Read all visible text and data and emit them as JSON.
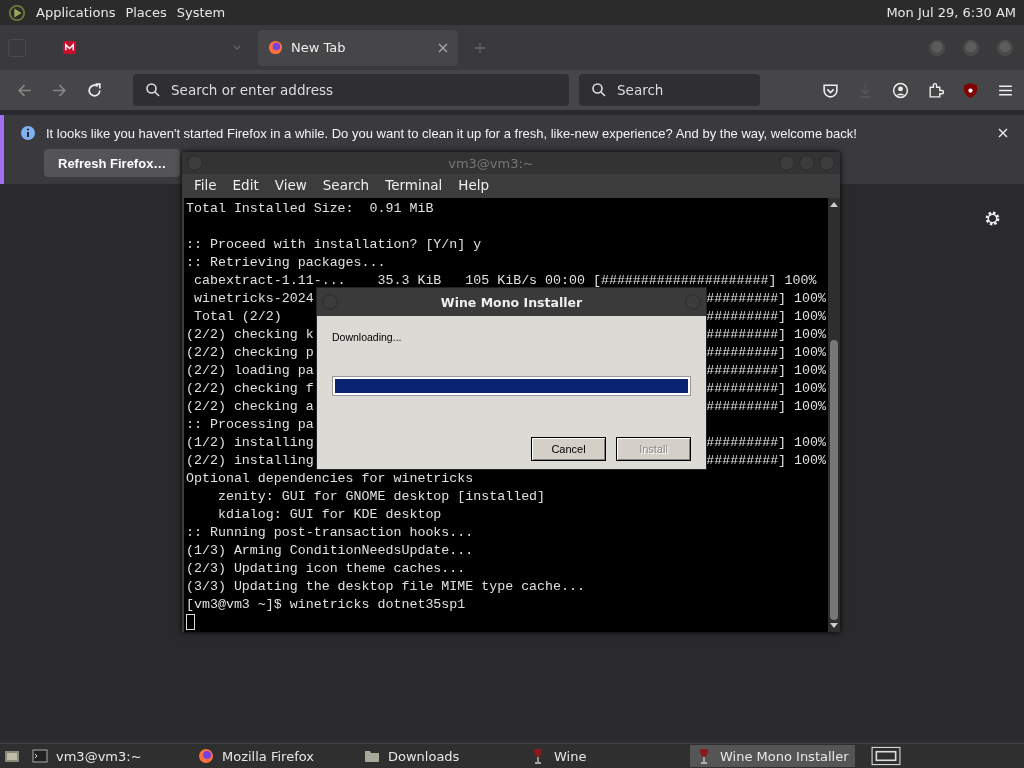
{
  "top_panel": {
    "menus": [
      "Applications",
      "Places",
      "System"
    ],
    "clock": "Mon Jul 29, 6:30 AM"
  },
  "browser": {
    "tabs": [
      {
        "selected": false
      },
      {
        "label": "New Tab",
        "selected": true
      }
    ],
    "address_bar": {
      "placeholder": "Search or enter address"
    },
    "search_bar": {
      "placeholder": "Search"
    },
    "notification": {
      "message": "It looks like you haven't started Firefox in a while. Do you want to clean it up for a fresh, like-new experience? And by the way, welcome back!",
      "button": "Refresh Firefox…"
    }
  },
  "terminal": {
    "title": "vm3@vm3:~",
    "menu": [
      "File",
      "Edit",
      "View",
      "Search",
      "Terminal",
      "Help"
    ],
    "lines": [
      {
        "left": "Total Installed Size:  0.91 MiB"
      },
      {
        "kind": "blank"
      },
      {
        "left": ":: Proceed with installation? [Y/n] y"
      },
      {
        "left": ":: Retrieving packages..."
      },
      {
        "left": " cabextract-1.11-...    35.3 KiB   105 KiB/s 00:00 [#####################] 100%"
      },
      {
        "left": " winetricks-2024",
        "right": "#########] 100%"
      },
      {
        "left": " Total (2/2)",
        "right": "#########] 100%"
      },
      {
        "left": "(2/2) checking k",
        "right": "#########] 100%"
      },
      {
        "left": "(2/2) checking p",
        "right": "#########] 100%"
      },
      {
        "left": "(2/2) loading pa",
        "right": "#########] 100%"
      },
      {
        "left": "(2/2) checking f",
        "right": "#########] 100%"
      },
      {
        "left": "(2/2) checking a",
        "right": "#########] 100%"
      },
      {
        "left": ":: Processing pa"
      },
      {
        "left": "(1/2) installing",
        "right": "#########] 100%"
      },
      {
        "left": "(2/2) installing",
        "right": "#########] 100%"
      },
      {
        "left": "Optional dependencies for winetricks"
      },
      {
        "left": "    zenity: GUI for GNOME desktop [installed]"
      },
      {
        "left": "    kdialog: GUI for KDE desktop"
      },
      {
        "left": ":: Running post-transaction hooks..."
      },
      {
        "left": "(1/3) Arming ConditionNeedsUpdate..."
      },
      {
        "left": "(2/3) Updating icon theme caches..."
      },
      {
        "left": "(3/3) Updating the desktop file MIME type cache..."
      },
      {
        "left": "[vm3@vm3 ~]$ winetricks dotnet35sp1"
      }
    ]
  },
  "dialog": {
    "title": "Wine Mono Installer",
    "status": "Downloading...",
    "progress": {
      "level": 1
    },
    "buttons": [
      {
        "label": "Cancel",
        "disabled": false
      },
      {
        "label": "Install",
        "disabled": true
      }
    ]
  },
  "taskbar": {
    "items": [
      {
        "label": "vm3@vm3:~",
        "kind": "terminal",
        "selected": false
      },
      {
        "label": "Mozilla Firefox",
        "kind": "firefox",
        "selected": false
      },
      {
        "label": "Downloads",
        "kind": "folder",
        "selected": false
      },
      {
        "label": "Wine",
        "kind": "wine",
        "selected": false
      },
      {
        "label": "Wine Mono Installer",
        "kind": "wine",
        "selected": true
      }
    ]
  }
}
